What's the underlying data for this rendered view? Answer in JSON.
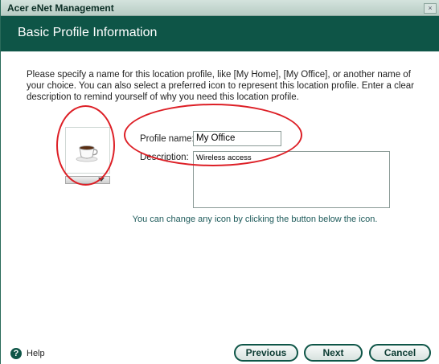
{
  "window": {
    "title": "Acer eNet Management",
    "close_label": "×"
  },
  "header": {
    "title": "Basic Profile Information"
  },
  "instructions": "Please specify a name for this location profile, like [My Home], [My Office], or another name of your choice. You can also select a preferred icon to represent this location profile. Enter a clear description to remind yourself of why you need this location profile.",
  "icon_selector": {
    "icon": "coffee-cup-icon"
  },
  "form": {
    "profile_name_label": "Profile name:",
    "profile_name_value": "My Office",
    "description_label": "Description:",
    "description_value": "Wireless access"
  },
  "hint": "You can change any icon by clicking the button below the icon.",
  "footer": {
    "help_label": "Help",
    "previous_label": "Previous",
    "next_label": "Next",
    "cancel_label": "Cancel"
  },
  "colors": {
    "header_bg": "#0e5547",
    "annotation_red": "#dd1f26"
  }
}
